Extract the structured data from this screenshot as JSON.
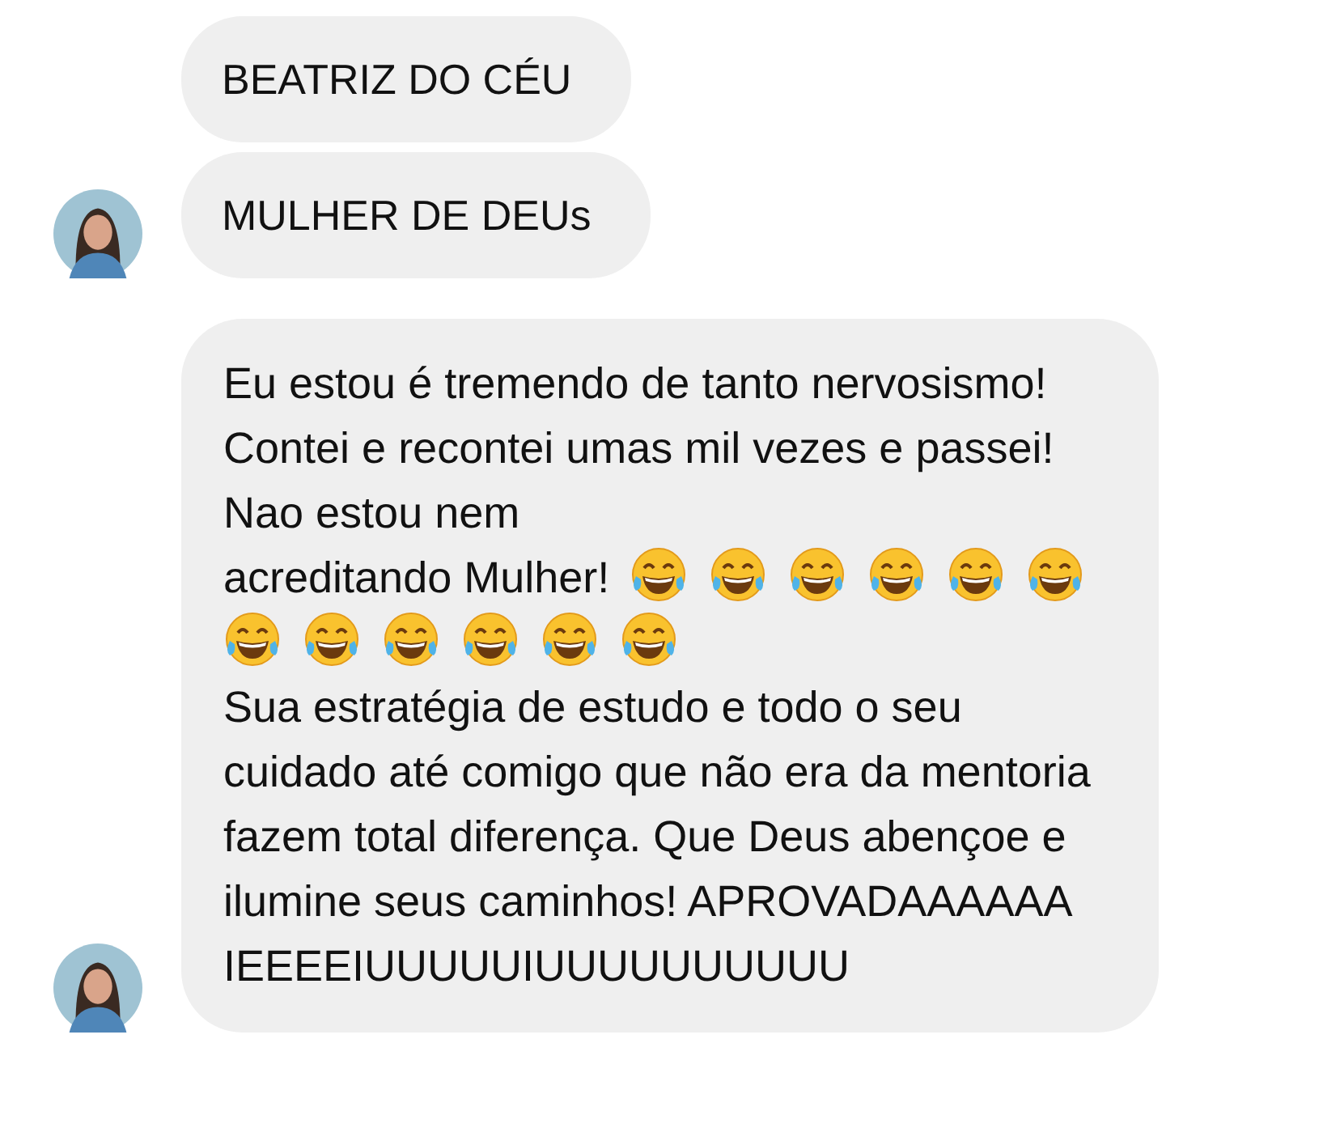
{
  "messages": [
    {
      "avatar": false,
      "parts": [
        {
          "kind": "text",
          "text": "BEATRIZ DO CÉU"
        }
      ]
    },
    {
      "avatar": true,
      "parts": [
        {
          "kind": "text",
          "text": "MULHER DE DEUs"
        }
      ]
    },
    {
      "avatar": true,
      "parts": [
        {
          "kind": "paragraph",
          "text": "Eu estou é tremendo de tanto nervosismo! Contei e recontei umas mil vezes e passei! Nao estou nem"
        },
        {
          "kind": "text",
          "text": "acreditando Mulher!"
        },
        {
          "kind": "emoji"
        },
        {
          "kind": "emoji"
        },
        {
          "kind": "emoji"
        },
        {
          "kind": "emoji"
        },
        {
          "kind": "emoji"
        },
        {
          "kind": "emoji"
        },
        {
          "kind": "emoji"
        },
        {
          "kind": "emoji"
        },
        {
          "kind": "emoji"
        },
        {
          "kind": "emoji"
        },
        {
          "kind": "emoji"
        },
        {
          "kind": "emoji"
        },
        {
          "kind": "paragraph",
          "text": "Sua estratégia de estudo e todo o seu cuidado até comigo que não era da mentoria fazem total diferença. Que Deus abençoe e ilumine seus caminhos! APROVADAAAAAA IEEEEIUUUUUIUUUUUUUUUU"
        }
      ]
    }
  ]
}
